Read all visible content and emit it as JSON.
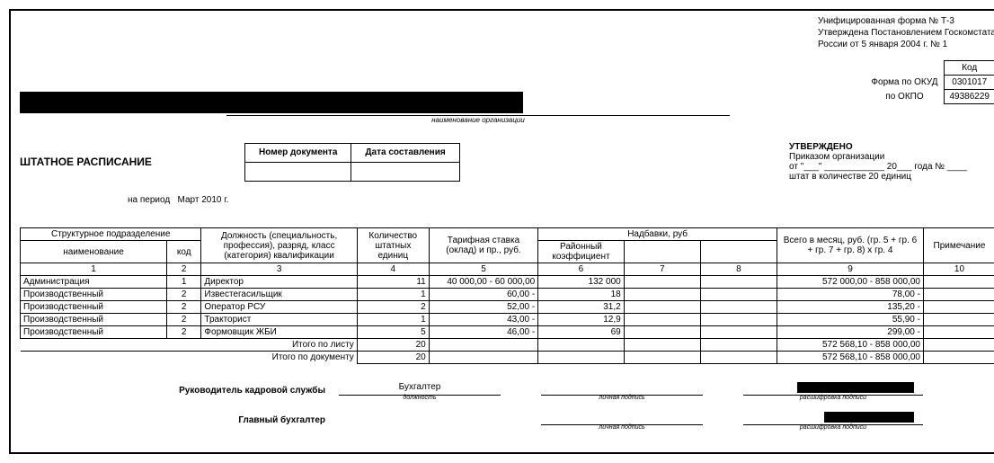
{
  "header": {
    "line1": "Унифицированная форма № Т-3",
    "line2": "Утверждена Постановлением Госкомстата",
    "line3": "России от 5 января 2004 г. № 1"
  },
  "codes": {
    "header": "Код",
    "okud_label": "Форма по ОКУД",
    "okud_value": "0301017",
    "okpo_label": "по ОКПО",
    "okpo_value": "49386229"
  },
  "org_caption": "наименование организации",
  "title": "ШТАТНОЕ РАСПИСАНИЕ",
  "doc_info": {
    "num_label": "Номер документа",
    "date_label": "Дата составления",
    "num_value": "",
    "date_value": ""
  },
  "approval": {
    "title": "УТВЕРЖДЕНО",
    "line1": "Приказом организации",
    "line2": "от \"___\" ____________ 20___ года № ____",
    "line3": "штат в количестве 20 единиц"
  },
  "period": {
    "label": "на период",
    "value": "Март 2010 г."
  },
  "columns": {
    "struct": "Структурное подразделение",
    "name": "наименование",
    "code": "код",
    "position": "Должность (специальность, профессия), разряд, класс (категория) квалификации",
    "count": "Количество штатных единиц",
    "rate": "Тарифная ставка (оклад) и пр., руб.",
    "allowances": "Надбавки, руб",
    "district": "Районный коэффициент",
    "total": "Всего в месяц, руб. (гр. 5 + гр. 6 + гр. 7 + гр. 8) x гр. 4",
    "note": "Примечание",
    "nums": [
      "1",
      "2",
      "3",
      "4",
      "5",
      "6",
      "7",
      "8",
      "9",
      "10"
    ]
  },
  "rows": [
    {
      "dept": "Администрация",
      "code": "1",
      "pos": "Директор",
      "cnt": "11",
      "rate": "40 000,00 - 60 000,00",
      "dk": "132 000",
      "c7": "",
      "c8": "",
      "total": "572 000,00 - 858 000,00",
      "note": ""
    },
    {
      "dept": "Производственный",
      "code": "2",
      "pos": "Известегасильщик",
      "cnt": "1",
      "rate": "60,00 -",
      "dk": "18",
      "c7": "",
      "c8": "",
      "total": "78,00 -",
      "note": ""
    },
    {
      "dept": "Производственный",
      "code": "2",
      "pos": "Оператор РСУ",
      "cnt": "2",
      "rate": "52,00 -",
      "dk": "31,2",
      "c7": "",
      "c8": "",
      "total": "135,20 -",
      "note": ""
    },
    {
      "dept": "Производственный",
      "code": "2",
      "pos": "Тракторист",
      "cnt": "1",
      "rate": "43,00 -",
      "dk": "12,9",
      "c7": "",
      "c8": "",
      "total": "55,90 -",
      "note": ""
    },
    {
      "dept": "Производственный",
      "code": "2",
      "pos": "Формовщик ЖБИ",
      "cnt": "5",
      "rate": "46,00 -",
      "dk": "69",
      "c7": "",
      "c8": "",
      "total": "299,00 -",
      "note": ""
    }
  ],
  "totals": {
    "sheet_label": "Итого по листу",
    "sheet_cnt": "20",
    "sheet_total": "572 568,10 - 858 000,00",
    "doc_label": "Итого по документу",
    "doc_cnt": "20",
    "doc_total": "572 568,10 - 858 000,00"
  },
  "signatures": {
    "hr_label": "Руководитель кадровой службы",
    "hr_pos": "Бухгалтер",
    "pos_caption": "должность",
    "sign_caption": "личная подпись",
    "dec_caption": "расшифровка подписи",
    "acc_label": "Главный бухгалтер"
  }
}
